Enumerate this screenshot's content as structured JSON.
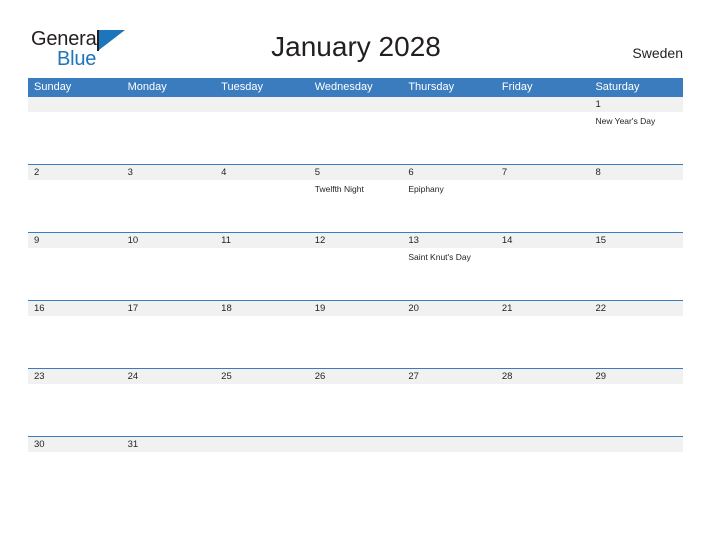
{
  "brand": {
    "logo_text_primary": "General",
    "logo_text_secondary": "Blue",
    "logo_icon": "blue-flag-triangle-icon"
  },
  "header": {
    "title": "January 2028",
    "country": "Sweden"
  },
  "theme": {
    "header_blue": "#3a7cbe",
    "rule_blue": "#3a7cbe",
    "date_band_gray": "#f1f1f1",
    "logo_blue": "#1d75bb",
    "text_dark": "#231f20"
  },
  "calendar": {
    "day_headers": [
      "Sunday",
      "Monday",
      "Tuesday",
      "Wednesday",
      "Thursday",
      "Friday",
      "Saturday"
    ],
    "weeks": [
      {
        "days": [
          {
            "date": "",
            "events": []
          },
          {
            "date": "",
            "events": []
          },
          {
            "date": "",
            "events": []
          },
          {
            "date": "",
            "events": []
          },
          {
            "date": "",
            "events": []
          },
          {
            "date": "",
            "events": []
          },
          {
            "date": "1",
            "events": [
              "New Year's Day"
            ]
          }
        ]
      },
      {
        "days": [
          {
            "date": "2",
            "events": []
          },
          {
            "date": "3",
            "events": []
          },
          {
            "date": "4",
            "events": []
          },
          {
            "date": "5",
            "events": [
              "Twelfth Night"
            ]
          },
          {
            "date": "6",
            "events": [
              "Epiphany"
            ]
          },
          {
            "date": "7",
            "events": []
          },
          {
            "date": "8",
            "events": []
          }
        ]
      },
      {
        "days": [
          {
            "date": "9",
            "events": []
          },
          {
            "date": "10",
            "events": []
          },
          {
            "date": "11",
            "events": []
          },
          {
            "date": "12",
            "events": []
          },
          {
            "date": "13",
            "events": [
              "Saint Knut's Day"
            ]
          },
          {
            "date": "14",
            "events": []
          },
          {
            "date": "15",
            "events": []
          }
        ]
      },
      {
        "days": [
          {
            "date": "16",
            "events": []
          },
          {
            "date": "17",
            "events": []
          },
          {
            "date": "18",
            "events": []
          },
          {
            "date": "19",
            "events": []
          },
          {
            "date": "20",
            "events": []
          },
          {
            "date": "21",
            "events": []
          },
          {
            "date": "22",
            "events": []
          }
        ]
      },
      {
        "days": [
          {
            "date": "23",
            "events": []
          },
          {
            "date": "24",
            "events": []
          },
          {
            "date": "25",
            "events": []
          },
          {
            "date": "26",
            "events": []
          },
          {
            "date": "27",
            "events": []
          },
          {
            "date": "28",
            "events": []
          },
          {
            "date": "29",
            "events": []
          }
        ]
      },
      {
        "days": [
          {
            "date": "30",
            "events": []
          },
          {
            "date": "31",
            "events": []
          },
          {
            "date": "",
            "events": []
          },
          {
            "date": "",
            "events": []
          },
          {
            "date": "",
            "events": []
          },
          {
            "date": "",
            "events": []
          },
          {
            "date": "",
            "events": []
          }
        ]
      }
    ]
  }
}
